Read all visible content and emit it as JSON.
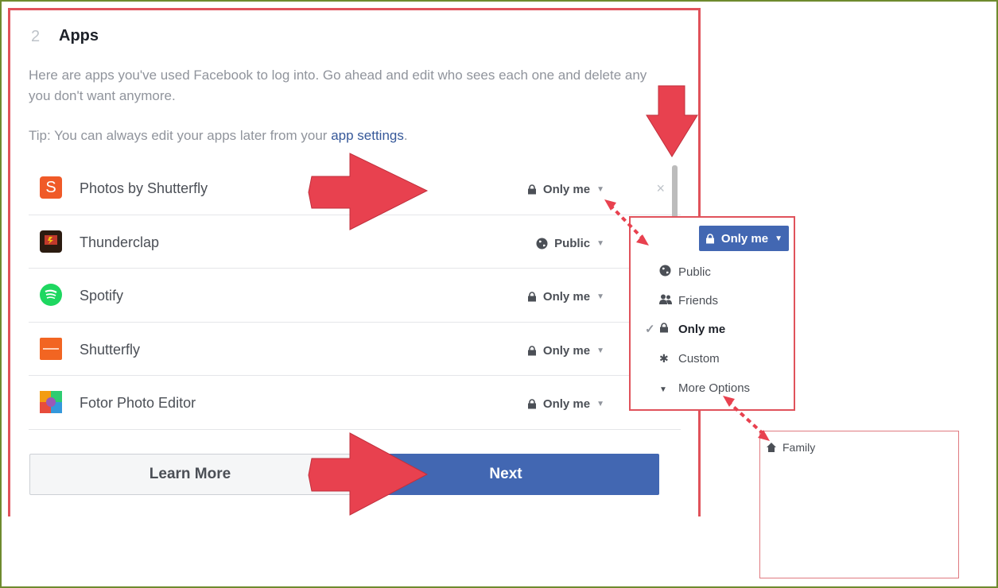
{
  "section": {
    "step": "2",
    "title": "Apps",
    "intro": "Here are apps you've used Facebook to log into. Go ahead and edit who sees each one and delete any you don't want anymore.",
    "tip_prefix": "Tip: You can always edit your apps later from your ",
    "tip_link": "app settings",
    "tip_suffix": "."
  },
  "apps": [
    {
      "name": "Photos by Shutterfly",
      "privacy": "Only me",
      "privacy_icon": "lock-icon",
      "icon": "shutterfly-s-icon",
      "icon_color": "#f05a28",
      "icon_text": "S"
    },
    {
      "name": "Thunderclap",
      "privacy": "Public",
      "privacy_icon": "globe-icon",
      "icon": "thunderclap-icon",
      "icon_color": "#2b1b10"
    },
    {
      "name": "Spotify",
      "privacy": "Only me",
      "privacy_icon": "lock-icon",
      "icon": "spotify-icon",
      "icon_color": "#1ed760"
    },
    {
      "name": "Shutterfly",
      "privacy": "Only me",
      "privacy_icon": "lock-icon",
      "icon": "shutterfly-icon",
      "icon_color": "#f26522"
    },
    {
      "name": "Fotor Photo Editor",
      "privacy": "Only me",
      "privacy_icon": "lock-icon",
      "icon": "fotor-icon",
      "icon_color": "#e6b800"
    }
  ],
  "remove_label": "×",
  "buttons": {
    "learn_more": "Learn More",
    "next": "Next"
  },
  "dropdown": {
    "selected": "Only me",
    "options": [
      {
        "label": "Public",
        "icon": "globe-icon",
        "checked": false
      },
      {
        "label": "Friends",
        "icon": "friends-icon",
        "checked": false
      },
      {
        "label": "Only me",
        "icon": "lock-icon",
        "checked": true
      },
      {
        "label": "Custom",
        "icon": "gear-icon",
        "checked": false
      },
      {
        "label": "More Options",
        "icon": "triangle-down-icon",
        "checked": false
      }
    ],
    "check_mark": "✓"
  },
  "more_options": {
    "items": [
      {
        "label": "Family",
        "icon": "house-icon"
      }
    ]
  },
  "colors": {
    "fb_blue": "#4267b2",
    "link": "#365899",
    "annotation_red": "#e8414f",
    "frame_green": "#6e8a2e"
  }
}
